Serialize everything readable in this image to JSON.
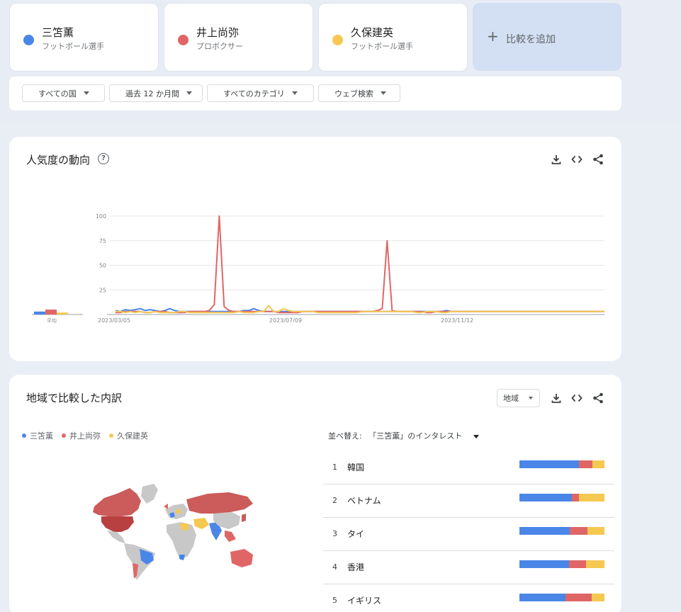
{
  "terms": [
    {
      "name": "三笘薫",
      "sub": "フットボール選手",
      "color": "#4a86e8"
    },
    {
      "name": "井上尚弥",
      "sub": "プロボクサー",
      "color": "#e06666"
    },
    {
      "name": "久保建英",
      "sub": "フットボール選手",
      "color": "#f5c850"
    }
  ],
  "add_compare": "比較を追加",
  "filters": [
    "すべての国",
    "過去 12 か月間",
    "すべてのカテゴリ",
    "ウェブ検索"
  ],
  "trend": {
    "title": "人気度の動向",
    "help_icon": "help-icon",
    "tools": [
      "download-icon",
      "embed-icon",
      "share-icon"
    ]
  },
  "chart_data": {
    "type": "line",
    "x_ticks": [
      "2023/03/05",
      "2023/07/09",
      "2023/11/12"
    ],
    "y_ticks": [
      "100",
      "75",
      "50",
      "25"
    ],
    "ylim": [
      0,
      100
    ],
    "average_label": "平均",
    "averages": [
      3,
      5,
      2
    ],
    "series": [
      {
        "name": "三笘薫",
        "color": "#4a86e8",
        "values": [
          4,
          3,
          5,
          4,
          5,
          6,
          4,
          5,
          4,
          3,
          4,
          6,
          4,
          3,
          3,
          3,
          3,
          3,
          3,
          3,
          3,
          3,
          3,
          3,
          3,
          3,
          4,
          4,
          6,
          4,
          3,
          3,
          3,
          3,
          3,
          3,
          3,
          3,
          3,
          3,
          3,
          3,
          3,
          3,
          3,
          3,
          3,
          3,
          3,
          3,
          3,
          3,
          3,
          3,
          3,
          3,
          3,
          3,
          3,
          3,
          3,
          3,
          3,
          3,
          3,
          3,
          3,
          4,
          3,
          3,
          3,
          3,
          3,
          3,
          3,
          3,
          3,
          3,
          3,
          3,
          3,
          3,
          3,
          3,
          3,
          3,
          3,
          3,
          3,
          3,
          3,
          3,
          3,
          3,
          3,
          3,
          3,
          3,
          3,
          3
        ]
      },
      {
        "name": "井上尚弥",
        "color": "#e06666",
        "values": [
          2,
          2,
          3,
          3,
          3,
          3,
          2,
          2,
          3,
          3,
          3,
          2,
          2,
          2,
          2,
          3,
          3,
          3,
          3,
          4,
          10,
          100,
          8,
          4,
          3,
          3,
          3,
          3,
          3,
          3,
          3,
          3,
          3,
          2,
          2,
          2,
          2,
          2,
          3,
          3,
          3,
          3,
          3,
          3,
          3,
          3,
          3,
          3,
          3,
          3,
          3,
          3,
          3,
          4,
          6,
          75,
          4,
          3,
          3,
          3,
          3,
          3,
          3,
          2,
          2,
          3,
          3,
          3,
          3,
          3,
          3,
          3,
          3,
          3,
          3,
          3,
          3,
          3,
          3,
          3,
          3,
          3,
          3,
          3,
          3,
          3,
          3,
          3,
          3,
          3,
          3,
          3,
          3,
          3,
          3,
          3,
          3,
          3,
          3,
          3
        ]
      },
      {
        "name": "久保建英",
        "color": "#f5c850",
        "values": [
          3,
          3,
          2,
          3,
          2,
          3,
          2,
          2,
          3,
          2,
          2,
          2,
          2,
          3,
          3,
          2,
          2,
          2,
          2,
          2,
          2,
          2,
          2,
          2,
          2,
          3,
          2,
          2,
          2,
          3,
          3,
          9,
          3,
          3,
          6,
          4,
          3,
          3,
          3,
          3,
          3,
          2,
          2,
          2,
          2,
          2,
          2,
          2,
          2,
          2,
          3,
          3,
          3,
          3,
          3,
          3,
          3,
          3,
          3,
          3,
          3,
          2,
          2,
          3,
          3,
          3,
          2,
          2,
          3,
          3,
          3,
          3,
          3,
          3,
          3,
          3,
          3,
          3,
          3,
          3,
          3,
          3,
          3,
          3,
          3,
          3,
          3,
          3,
          3,
          3,
          3,
          3,
          3,
          3,
          3,
          3,
          3,
          3,
          3,
          3
        ]
      }
    ]
  },
  "region": {
    "title": "地域で比較した内訳",
    "select_label": "地域",
    "legend": [
      "三笘薫",
      "井上尚弥",
      "久保建英"
    ],
    "sort_prefix": "並べ替え:",
    "sort_value": "「三笘薫」のインタレスト",
    "rows": [
      {
        "rank": "1",
        "name": "韓国",
        "shares": [
          70,
          16,
          14
        ]
      },
      {
        "rank": "2",
        "name": "ベトナム",
        "shares": [
          62,
          8,
          30
        ]
      },
      {
        "rank": "3",
        "name": "タイ",
        "shares": [
          59,
          21,
          20
        ]
      },
      {
        "rank": "4",
        "name": "香港",
        "shares": [
          58,
          20,
          22
        ]
      },
      {
        "rank": "5",
        "name": "イギリス",
        "shares": [
          54,
          31,
          15
        ]
      }
    ]
  }
}
